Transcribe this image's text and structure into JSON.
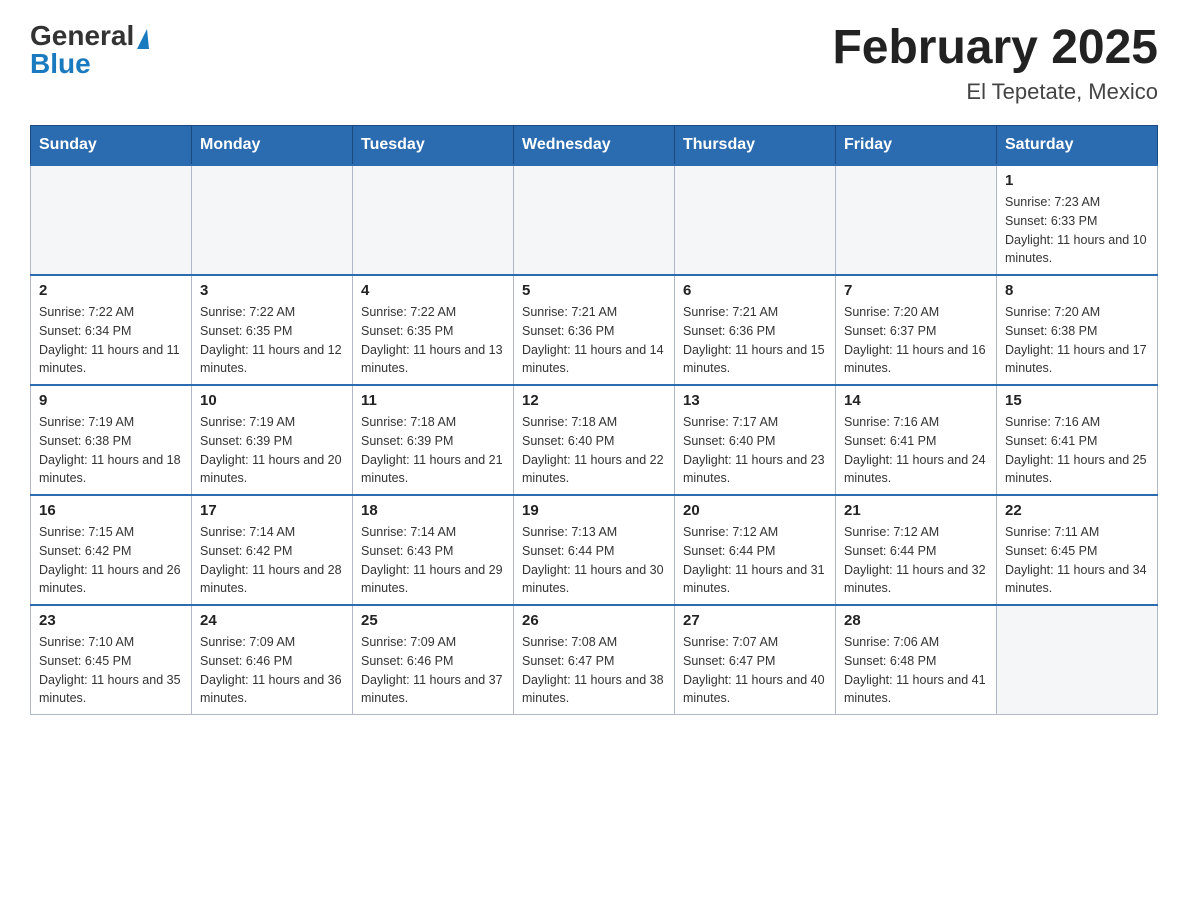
{
  "header": {
    "title": "February 2025",
    "subtitle": "El Tepetate, Mexico"
  },
  "logo": {
    "line1": "General",
    "line2": "Blue"
  },
  "days_of_week": [
    "Sunday",
    "Monday",
    "Tuesday",
    "Wednesday",
    "Thursday",
    "Friday",
    "Saturday"
  ],
  "weeks": [
    [
      {
        "day": "",
        "info": ""
      },
      {
        "day": "",
        "info": ""
      },
      {
        "day": "",
        "info": ""
      },
      {
        "day": "",
        "info": ""
      },
      {
        "day": "",
        "info": ""
      },
      {
        "day": "",
        "info": ""
      },
      {
        "day": "1",
        "info": "Sunrise: 7:23 AM\nSunset: 6:33 PM\nDaylight: 11 hours and 10 minutes."
      }
    ],
    [
      {
        "day": "2",
        "info": "Sunrise: 7:22 AM\nSunset: 6:34 PM\nDaylight: 11 hours and 11 minutes."
      },
      {
        "day": "3",
        "info": "Sunrise: 7:22 AM\nSunset: 6:35 PM\nDaylight: 11 hours and 12 minutes."
      },
      {
        "day": "4",
        "info": "Sunrise: 7:22 AM\nSunset: 6:35 PM\nDaylight: 11 hours and 13 minutes."
      },
      {
        "day": "5",
        "info": "Sunrise: 7:21 AM\nSunset: 6:36 PM\nDaylight: 11 hours and 14 minutes."
      },
      {
        "day": "6",
        "info": "Sunrise: 7:21 AM\nSunset: 6:36 PM\nDaylight: 11 hours and 15 minutes."
      },
      {
        "day": "7",
        "info": "Sunrise: 7:20 AM\nSunset: 6:37 PM\nDaylight: 11 hours and 16 minutes."
      },
      {
        "day": "8",
        "info": "Sunrise: 7:20 AM\nSunset: 6:38 PM\nDaylight: 11 hours and 17 minutes."
      }
    ],
    [
      {
        "day": "9",
        "info": "Sunrise: 7:19 AM\nSunset: 6:38 PM\nDaylight: 11 hours and 18 minutes."
      },
      {
        "day": "10",
        "info": "Sunrise: 7:19 AM\nSunset: 6:39 PM\nDaylight: 11 hours and 20 minutes."
      },
      {
        "day": "11",
        "info": "Sunrise: 7:18 AM\nSunset: 6:39 PM\nDaylight: 11 hours and 21 minutes."
      },
      {
        "day": "12",
        "info": "Sunrise: 7:18 AM\nSunset: 6:40 PM\nDaylight: 11 hours and 22 minutes."
      },
      {
        "day": "13",
        "info": "Sunrise: 7:17 AM\nSunset: 6:40 PM\nDaylight: 11 hours and 23 minutes."
      },
      {
        "day": "14",
        "info": "Sunrise: 7:16 AM\nSunset: 6:41 PM\nDaylight: 11 hours and 24 minutes."
      },
      {
        "day": "15",
        "info": "Sunrise: 7:16 AM\nSunset: 6:41 PM\nDaylight: 11 hours and 25 minutes."
      }
    ],
    [
      {
        "day": "16",
        "info": "Sunrise: 7:15 AM\nSunset: 6:42 PM\nDaylight: 11 hours and 26 minutes."
      },
      {
        "day": "17",
        "info": "Sunrise: 7:14 AM\nSunset: 6:42 PM\nDaylight: 11 hours and 28 minutes."
      },
      {
        "day": "18",
        "info": "Sunrise: 7:14 AM\nSunset: 6:43 PM\nDaylight: 11 hours and 29 minutes."
      },
      {
        "day": "19",
        "info": "Sunrise: 7:13 AM\nSunset: 6:44 PM\nDaylight: 11 hours and 30 minutes."
      },
      {
        "day": "20",
        "info": "Sunrise: 7:12 AM\nSunset: 6:44 PM\nDaylight: 11 hours and 31 minutes."
      },
      {
        "day": "21",
        "info": "Sunrise: 7:12 AM\nSunset: 6:44 PM\nDaylight: 11 hours and 32 minutes."
      },
      {
        "day": "22",
        "info": "Sunrise: 7:11 AM\nSunset: 6:45 PM\nDaylight: 11 hours and 34 minutes."
      }
    ],
    [
      {
        "day": "23",
        "info": "Sunrise: 7:10 AM\nSunset: 6:45 PM\nDaylight: 11 hours and 35 minutes."
      },
      {
        "day": "24",
        "info": "Sunrise: 7:09 AM\nSunset: 6:46 PM\nDaylight: 11 hours and 36 minutes."
      },
      {
        "day": "25",
        "info": "Sunrise: 7:09 AM\nSunset: 6:46 PM\nDaylight: 11 hours and 37 minutes."
      },
      {
        "day": "26",
        "info": "Sunrise: 7:08 AM\nSunset: 6:47 PM\nDaylight: 11 hours and 38 minutes."
      },
      {
        "day": "27",
        "info": "Sunrise: 7:07 AM\nSunset: 6:47 PM\nDaylight: 11 hours and 40 minutes."
      },
      {
        "day": "28",
        "info": "Sunrise: 7:06 AM\nSunset: 6:48 PM\nDaylight: 11 hours and 41 minutes."
      },
      {
        "day": "",
        "info": ""
      }
    ]
  ]
}
